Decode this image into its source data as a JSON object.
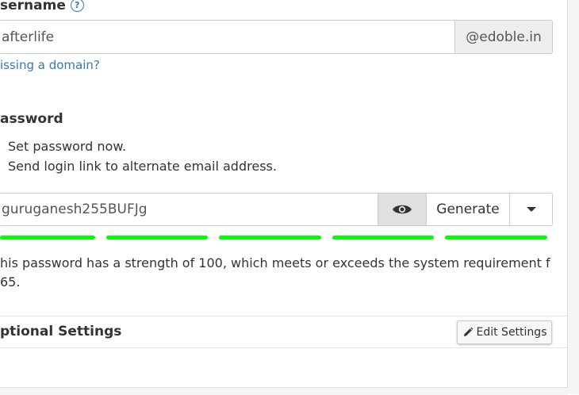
{
  "username": {
    "label": "sername",
    "value": "afterlife",
    "domain_suffix": "@edoble.in",
    "missing_domain_link": "issing a domain?"
  },
  "password": {
    "label": "assword",
    "options": [
      "Set password now.",
      "Send login link to alternate email address."
    ],
    "value": "guruganesh255BUFJg",
    "generate_label": "Generate",
    "strength_segments": 5,
    "strength_color": "#00ff00",
    "strength_message": "his password has a strength of 100, which meets or exceeds the system requirement f 65."
  },
  "optional_settings": {
    "label": "ptional Settings",
    "edit_button": "Edit Settings"
  },
  "colors": {
    "link": "#337ab7",
    "strength": "#00ff00"
  }
}
